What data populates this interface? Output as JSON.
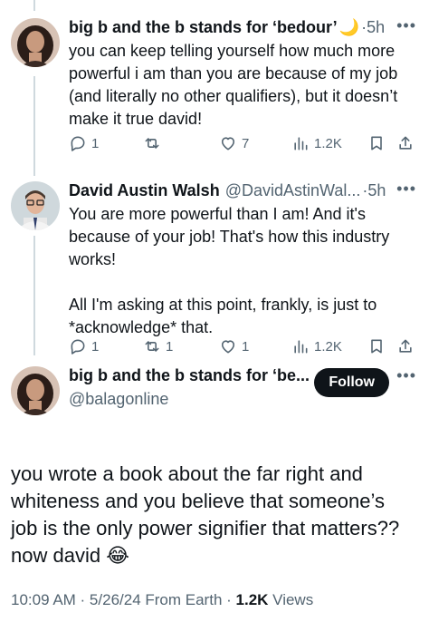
{
  "tweets": [
    {
      "name": "big b and the b stands for ‘bedour’",
      "handle": "",
      "name_emoji": "🌙",
      "sep": "·",
      "time": "5h",
      "text": "you can keep telling yourself how much more powerful i am than you are because of my job (and literally no other qualifiers), but it doesn’t make it true david!",
      "replies": "1",
      "retweets": "",
      "likes": "7",
      "views": "1.2K"
    },
    {
      "name": "David Austin Walsh",
      "handle": "@DavidAstinWal...",
      "sep": "·",
      "time": "5h",
      "text": "You are more powerful than I am! And it's because of your job! That's how this industry works!\n\nAll I'm asking at this point, frankly, is just to *acknowledge* that.",
      "replies": "1",
      "retweets": "1",
      "likes": "1",
      "views": "1.2K"
    }
  ],
  "main": {
    "name": "big b and the b stands for ‘be...",
    "handle": "@balagonline",
    "follow_label": "Follow",
    "text": "you wrote a book about the far right and whiteness and you believe that someone’s job is the only power signifier that matters?? now david",
    "emoji": "😂",
    "timestamp": "10:09 AM · 5/26/24 From Earth · ",
    "views_count": "1.2K",
    "views_label": " Views"
  },
  "icons": {
    "more": "more-horizontal-icon",
    "reply": "reply-icon",
    "retweet": "retweet-icon",
    "like": "heart-icon",
    "views": "views-chart-icon",
    "bookmark": "bookmark-icon",
    "share": "share-icon"
  }
}
